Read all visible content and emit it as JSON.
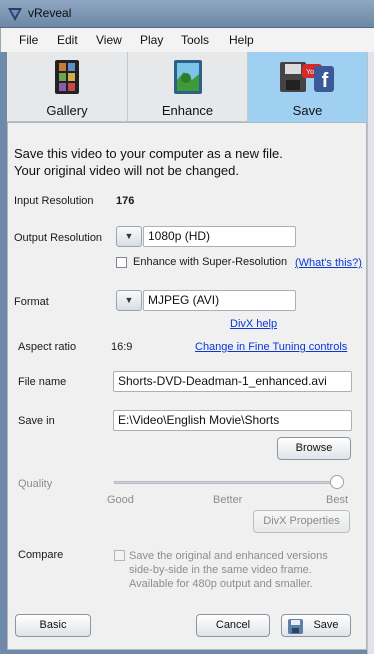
{
  "window": {
    "title": "vReveal"
  },
  "menu": [
    "File",
    "Edit",
    "View",
    "Play",
    "Tools",
    "Help"
  ],
  "tabs": [
    {
      "label": "Gallery",
      "icon": "film-strip-icon",
      "active": false
    },
    {
      "label": "Enhance",
      "icon": "landscape-photo-icon",
      "active": false
    },
    {
      "label": "Save",
      "icon": "save-youtube-facebook-icon",
      "active": true
    }
  ],
  "intro": {
    "line1": "Save this video to your computer as a new file.",
    "line2": "Your original video will not be changed."
  },
  "input_resolution": {
    "label": "Input Resolution",
    "value": "176"
  },
  "output_resolution": {
    "label": "Output Resolution",
    "value": "1080p (HD)"
  },
  "super_resolution": {
    "label": "Enhance with Super-Resolution",
    "checked": false,
    "help_link": "(What's this?)"
  },
  "format": {
    "label": "Format",
    "value": "MJPEG (AVI)",
    "help_link": "DivX help"
  },
  "aspect_ratio": {
    "label": "Aspect ratio",
    "value": "16:9",
    "link": "Change in Fine Tuning controls"
  },
  "file_name": {
    "label": "File name",
    "value": "Shorts-DVD-Deadman-1_enhanced.avi"
  },
  "save_in": {
    "label": "Save in",
    "value": "E:\\Video\\English Movie\\Shorts",
    "browse_label": "Browse"
  },
  "quality": {
    "label": "Quality",
    "level": 1.0,
    "ticks": [
      "Good",
      "Better",
      "Best"
    ],
    "properties_label": "DivX Properties"
  },
  "compare": {
    "label": "Compare",
    "checked": false,
    "text1": "Save the original and enhanced versions",
    "text2": "side-by-side in the same video frame.",
    "text3": "Available for 480p output and smaller."
  },
  "footer": {
    "basic_label": "Basic",
    "cancel_label": "Cancel",
    "save_label": "Save"
  },
  "colors": {
    "active_tab": "#9fd0f2",
    "link": "#0b36d6",
    "titlebar": "#7a93b1"
  }
}
